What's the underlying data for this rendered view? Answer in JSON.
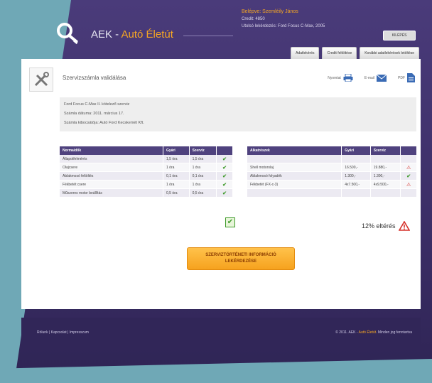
{
  "header": {
    "logo_prefix": "AEK - ",
    "logo_accent": "Autó Életút",
    "user_name": "Belépve: Szemléily János",
    "credit": "Credit: 4850",
    "last_query": "Utolsó lekérdezés: Ford Focus C-Max, 2005",
    "logout_label": "KILÉPÉS"
  },
  "tabs": [
    {
      "label": "Adatlekérés"
    },
    {
      "label": "Credit feltöltése"
    },
    {
      "label": "Korábbi adatlekérések letöltése"
    }
  ],
  "page": {
    "title": "Szervizszámla validálása",
    "print_label": "Nyomtat",
    "email_label": "E-mail",
    "pdf_label": "PDF"
  },
  "info": {
    "line1": "Ford Focus C-Max II. kötelező szerviz",
    "line2": "Számla dátuma: 2011. március 17.",
    "line3": "Számla kibocsátója: Autó Ford Kecskemét Kft."
  },
  "norms_table": {
    "headers": [
      "Normaidők",
      "Gyári",
      "Szerviz",
      ""
    ],
    "rows": [
      [
        "Állapotfelmérés",
        "1,5 óra",
        "1,5 óra"
      ],
      [
        "Olajcsere",
        "1 óra",
        "1 óra"
      ],
      [
        "Ablakmosó feltöltés",
        "0,1 óra",
        "0,1 óra"
      ],
      [
        "Fékbetét csere",
        "1 óra",
        "1 óra"
      ],
      [
        "Műszeres motor beállítás",
        "0,5 óra",
        "0,5 óra"
      ]
    ]
  },
  "parts_table": {
    "headers": [
      "Alkatrészek",
      "Gyári",
      "Szerviz",
      ""
    ],
    "rows": [
      [
        "",
        "",
        ""
      ],
      [
        "Shell motorolaj",
        "16.500,-",
        "19.880,-"
      ],
      [
        "Ablakmosó folyadék",
        "1.300,-",
        "1.300,-"
      ],
      [
        "Fékbetét (FX-c-3)",
        "4x7.500,-",
        "4x9.500,-"
      ],
      [
        "",
        "",
        ""
      ]
    ]
  },
  "diff_text": "12% eltérés",
  "cta": {
    "line1": "SZERVIZTÖRTÉNETI INFORMÁCIÓ",
    "line2": "LEKÉRDEZÉSE"
  },
  "footer": {
    "links": "Rólunk  |  Kapcsolat  |  Impresszum",
    "copy_prefix": "© 2011. AEK - ",
    "copy_accent": "Autó Életút",
    "copy_suffix": ". Minden jog fenntartva"
  }
}
